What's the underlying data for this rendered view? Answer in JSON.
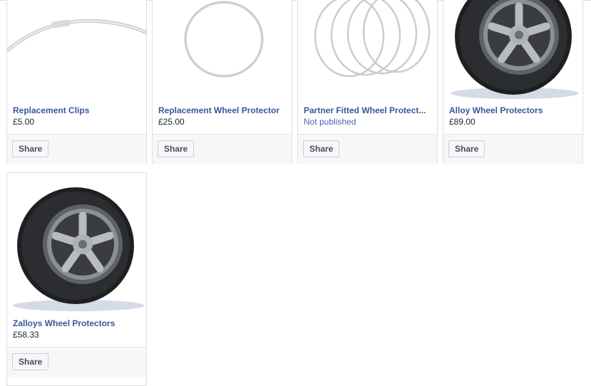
{
  "products": [
    {
      "title": "Replacement Clips",
      "price": "£5.00",
      "image": "clip-ring-image",
      "share_label": "Share"
    },
    {
      "title": "Replacement Wheel Protector",
      "price": "£25.00",
      "image": "single-ring-image",
      "share_label": "Share"
    },
    {
      "title": "Partner Fitted Wheel Protect...",
      "price": "Not published",
      "image": "four-rings-image",
      "share_label": "Share"
    },
    {
      "title": "Alloy Wheel Protectors",
      "price": "£89.00",
      "image": "alloy-wheel-image",
      "share_label": "Share"
    },
    {
      "title": "Zalloys Wheel Protectors",
      "price": "£58.33",
      "image": "alloy-wheel-image",
      "share_label": "Share"
    }
  ],
  "colors": {
    "link": "#365899",
    "unpublished": "#4267b2",
    "footer_bg": "#f6f7f9",
    "border": "#dddfe2"
  }
}
